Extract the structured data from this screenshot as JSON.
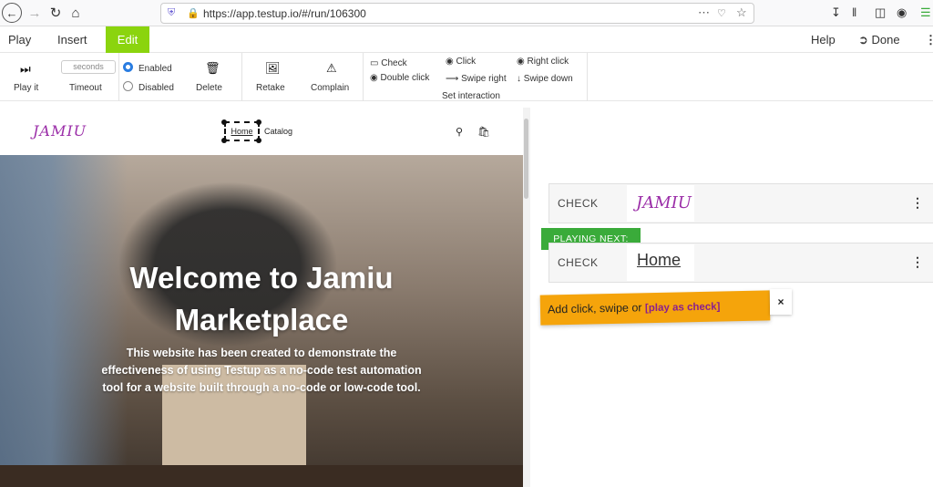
{
  "browser": {
    "url": "https://app.testup.io/#/run/106300",
    "icons": [
      "back-icon",
      "forward-icon",
      "reload-icon",
      "home-icon",
      "shield-icon",
      "lock-icon",
      "more-icon",
      "pocket-icon",
      "star-icon",
      "download-icon",
      "library-icon",
      "sidebar-icon",
      "account-icon",
      "menu-icon"
    ]
  },
  "app": {
    "tabs": [
      "Play",
      "Insert",
      "Edit"
    ],
    "active_tab": "Edit",
    "right": {
      "help": "Help",
      "done": "Done"
    },
    "tools": {
      "play_it": "Play it",
      "timeout_placeholder": "seconds",
      "timeout": "Timeout",
      "enabled": "Enabled",
      "disabled": "Disabled",
      "delete": "Delete",
      "retake": "Retake",
      "complain": "Complain",
      "check": "Check",
      "double_click": "Double click",
      "click": "Click",
      "swipe_right": "Swipe right",
      "right_click": "Right click",
      "swipe_down": "Swipe down",
      "set_interaction": "Set interaction"
    }
  },
  "site": {
    "logo": "JAMIU",
    "nav": {
      "home": "Home",
      "catalog": "Catalog"
    },
    "hero": {
      "title_line1": "Welcome to Jamiu",
      "title_line2": "Marketplace",
      "desc_line1": "This website has been created to demonstrate the",
      "desc_line2": "effectiveness of using Testup as a no-code test automation",
      "desc_line3": "tool for a website built through a no-code or low-code tool."
    }
  },
  "steps": {
    "step1": {
      "label": "CHECK",
      "thumb": "JAMIU"
    },
    "playing_next": "PLAYING NEXT:",
    "step2": {
      "label": "CHECK",
      "thumb": "Home"
    },
    "hint": {
      "text": "Add click, swipe or ",
      "link": "[play as check]",
      "close": "×"
    }
  },
  "colors": {
    "accent_green": "#8bd40e",
    "playing_next": "#3aab3a",
    "hint": "#f5a40b",
    "brand_purple": "#9b2ea8"
  }
}
